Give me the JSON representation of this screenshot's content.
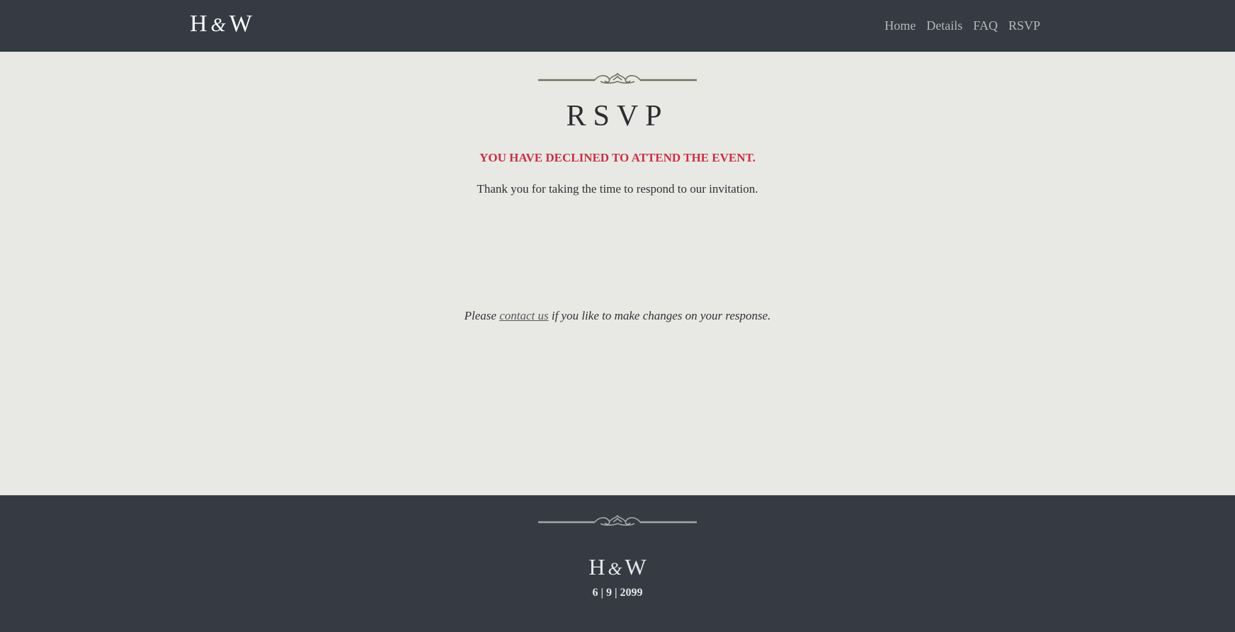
{
  "header": {
    "brand_left": "H",
    "brand_amp": "&",
    "brand_right": "W",
    "nav": [
      "Home",
      "Details",
      "FAQ",
      "RSVP"
    ]
  },
  "main": {
    "title": "RSVP",
    "declined_message": "You have declined to attend the event.",
    "thanks_message": "Thank you for taking the time to respond to our invitation.",
    "changes_prefix": "Please",
    "contact_link": "contact us",
    "changes_suffix": "if you like to make changes on your response."
  },
  "footer": {
    "brand_left": "H",
    "brand_amp": "&",
    "brand_right": "W",
    "date": "6 | 9 | 2099"
  },
  "colors": {
    "header_bg": "#363a43",
    "page_bg": "#e8e9e4",
    "accent_red": "#cc2e45",
    "ornament_main": "#6f715f",
    "ornament_footer": "#a5a7a9"
  },
  "icons": {
    "ornament": "flourish-divider-icon"
  }
}
